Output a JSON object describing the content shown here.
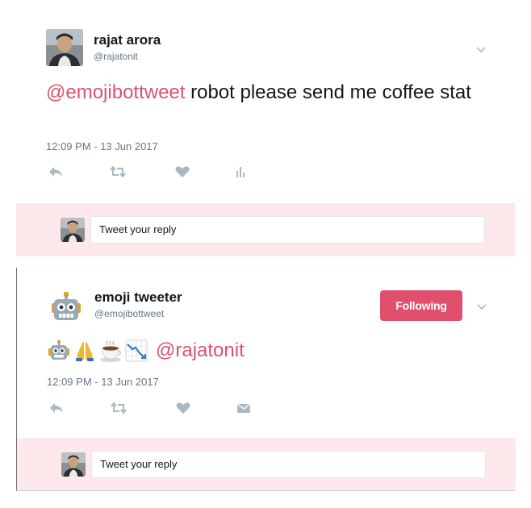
{
  "tweet1": {
    "author_name": "rajat arora",
    "author_handle": "@rajatonit",
    "mention": "@emojibottweet",
    "text": " robot please send me coffee stat",
    "timestamp": "12:09 PM - 13 Jun 2017",
    "actions": [
      "reply-icon",
      "retweet-icon",
      "like-icon",
      "analytics-icon"
    ],
    "reply_placeholder": "Tweet your reply"
  },
  "tweet2": {
    "author_name": "emoji tweeter",
    "author_handle": "@emojibottweet",
    "follow_label": "Following",
    "emojis": [
      "robot-emoji",
      "folded-hands-emoji",
      "hot-beverage-emoji",
      "chart-decreasing-emoji"
    ],
    "mention": "@rajatonit",
    "timestamp": "12:09 PM - 13 Jun 2017",
    "actions": [
      "reply-icon",
      "retweet-icon",
      "like-icon",
      "direct-message-icon"
    ],
    "reply_placeholder": "Tweet your reply"
  },
  "colors": {
    "mention": "#d9536f",
    "follow_button": "#e0506e",
    "reply_bar": "#fde8ec",
    "icon": "#aab8c2",
    "muted_text": "#657786"
  }
}
